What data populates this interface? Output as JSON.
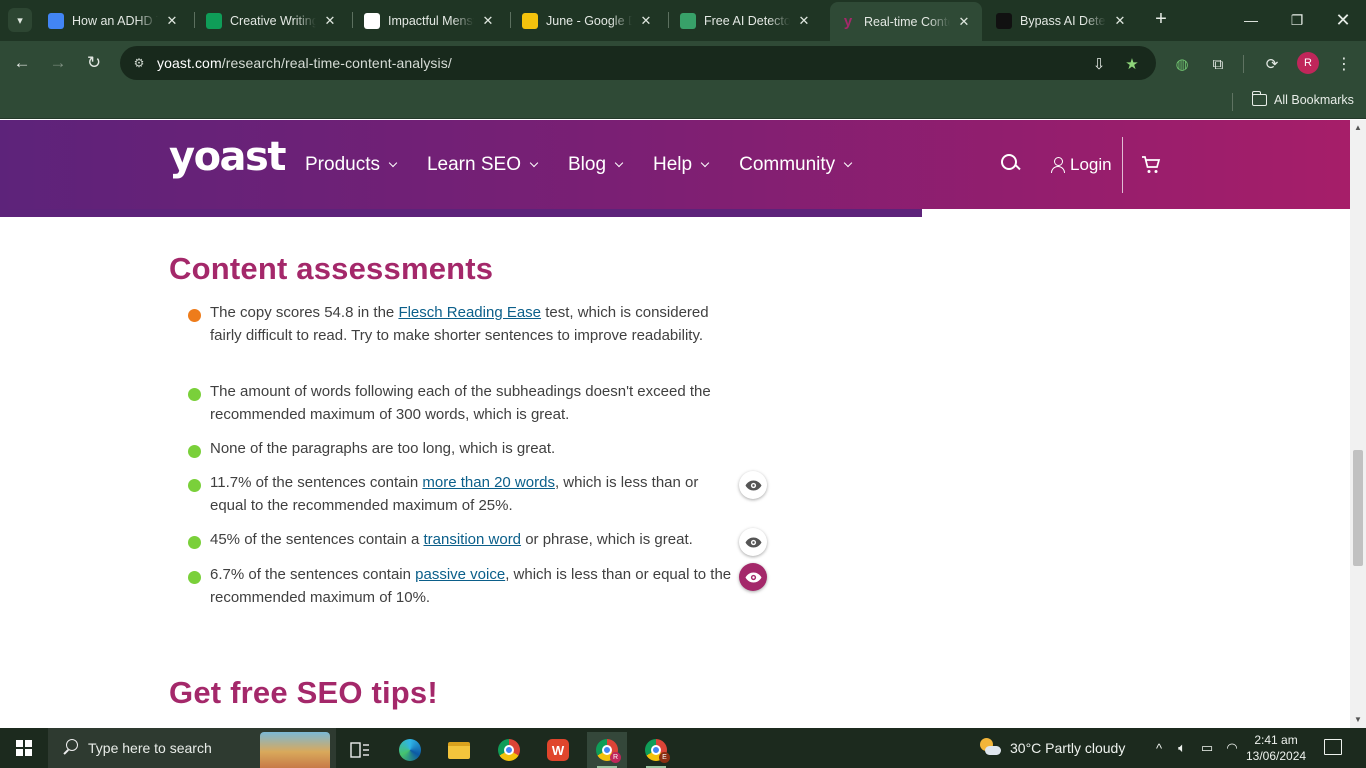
{
  "browser": {
    "tabs": [
      {
        "title": "How an ADHD Te",
        "favicon": "docs-icon",
        "color": "#4285f4"
      },
      {
        "title": "Creative Writing",
        "favicon": "sheets-icon",
        "color": "#0f9d58"
      },
      {
        "title": "Impactful Menst",
        "favicon": "chatgpt-icon",
        "color": "#ffffff"
      },
      {
        "title": "June - Google D",
        "favicon": "drive-icon",
        "color": "#f4c20d"
      },
      {
        "title": "Free AI Detector",
        "favicon": "robot-icon",
        "color": "#38a169"
      },
      {
        "title": "Real-time Conte",
        "favicon": "yoast-icon",
        "color": "#a4286a",
        "active": true
      },
      {
        "title": "Bypass AI Detect",
        "favicon": "openai-icon",
        "color": "#111111"
      }
    ],
    "url_host": "yoast.com",
    "url_path": "/research/real-time-content-analysis/",
    "profile_initial": "R",
    "bookmarks_label": "All Bookmarks"
  },
  "site": {
    "logo": "yoast",
    "nav": [
      "Products",
      "Learn SEO",
      "Blog",
      "Help",
      "Community"
    ],
    "login_label": "Login"
  },
  "content": {
    "heading": "Content assessments",
    "assessments": [
      {
        "status": "orange",
        "parts": [
          "The copy scores 54.8 in the ",
          {
            "link": "Flesch Reading Ease"
          },
          " test, which is considered fairly difficult to read. Try to make shorter sentences to improve readability."
        ],
        "eye": null
      },
      {
        "status": "green",
        "parts": [
          "The amount of words following each of the subheadings doesn't exceed the recommended maximum of 300 words, which is great."
        ],
        "eye": null
      },
      {
        "status": "green",
        "parts": [
          "None of the paragraphs are too long, which is great."
        ],
        "eye": null
      },
      {
        "status": "green",
        "parts": [
          "11.7% of the sentences contain ",
          {
            "link": "more than 20 words"
          },
          ", which is less than or equal to the recommended maximum of 25%."
        ],
        "eye": "inactive"
      },
      {
        "status": "green",
        "parts": [
          "45% of the sentences contain a ",
          {
            "link": "transition word"
          },
          " or phrase, which is great."
        ],
        "eye": "inactive"
      },
      {
        "status": "green",
        "parts": [
          "6.7% of the sentences contain ",
          {
            "link": "passive voice"
          },
          ", which is less than or equal to the recommended maximum of 10%."
        ],
        "eye": "active"
      }
    ],
    "next_heading": "Get free SEO tips!",
    "colors": {
      "orange": "#ee7c1b",
      "green": "#7ad03a",
      "heading": "#a4286a"
    }
  },
  "taskbar": {
    "search_placeholder": "Type here to search",
    "weather": "30°C  Partly cloudy",
    "time": "2:41 am",
    "date": "13/06/2024"
  }
}
